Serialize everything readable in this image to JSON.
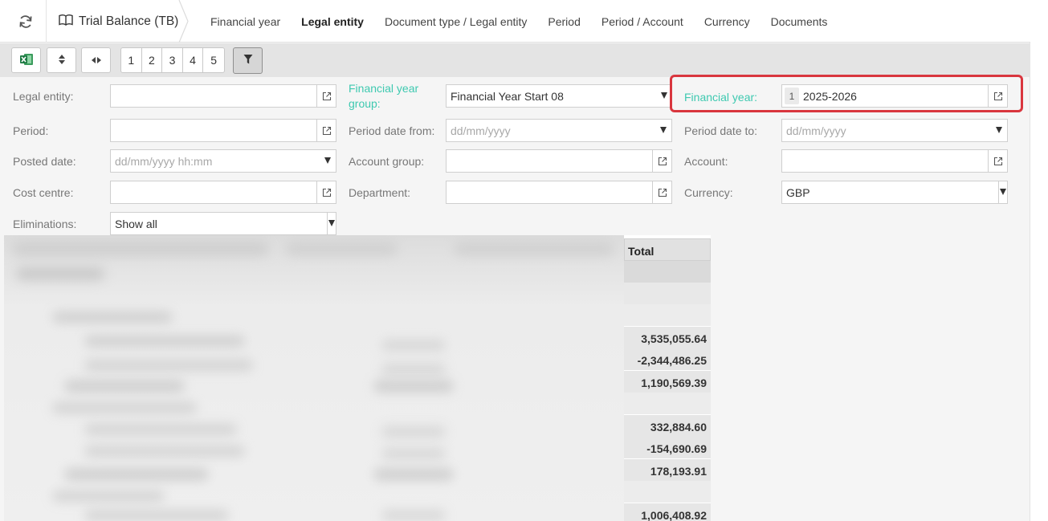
{
  "header": {
    "title": "Trial Balance (TB)",
    "tabs": [
      {
        "label": "Financial year",
        "active": false
      },
      {
        "label": "Legal entity",
        "active": true
      },
      {
        "label": "Document type / Legal entity",
        "active": false
      },
      {
        "label": "Period",
        "active": false
      },
      {
        "label": "Period / Account",
        "active": false
      },
      {
        "label": "Currency",
        "active": false
      },
      {
        "label": "Documents",
        "active": false
      }
    ]
  },
  "toolbar": {
    "pages": [
      "1",
      "2",
      "3",
      "4",
      "5"
    ],
    "icons": [
      "excel-icon",
      "sort-updown-icon",
      "expand-horizontal-icon",
      "filter-icon"
    ]
  },
  "filters": {
    "legal_entity": {
      "label": "Legal entity:",
      "value": ""
    },
    "fy_group": {
      "label": "Financial year group:",
      "value": "Financial Year Start 08"
    },
    "financial_year": {
      "label": "Financial year:",
      "badge": "1",
      "value": "2025-2026"
    },
    "period": {
      "label": "Period:",
      "value": ""
    },
    "period_from": {
      "label": "Period date from:",
      "placeholder": "dd/mm/yyyy"
    },
    "period_to": {
      "label": "Period date to:",
      "placeholder": "dd/mm/yyyy"
    },
    "posted_date": {
      "label": "Posted date:",
      "placeholder": "dd/mm/yyyy hh:mm"
    },
    "account_group": {
      "label": "Account group:",
      "value": ""
    },
    "account": {
      "label": "Account:",
      "value": ""
    },
    "cost_centre": {
      "label": "Cost centre:",
      "value": ""
    },
    "department": {
      "label": "Department:",
      "value": ""
    },
    "currency": {
      "label": "Currency:",
      "value": "GBP"
    },
    "eliminations": {
      "label": "Eliminations:",
      "value": "Show all"
    }
  },
  "grid": {
    "total_header": "Total",
    "total_values": [
      "3,535,055.64",
      "-2,344,486.25",
      "1,190,569.39",
      "332,884.60",
      "-154,690.69",
      "178,193.91",
      "1,006,408.92"
    ]
  },
  "colors": {
    "accent_green": "#3ec9b0",
    "highlight_red": "#d9363e"
  }
}
